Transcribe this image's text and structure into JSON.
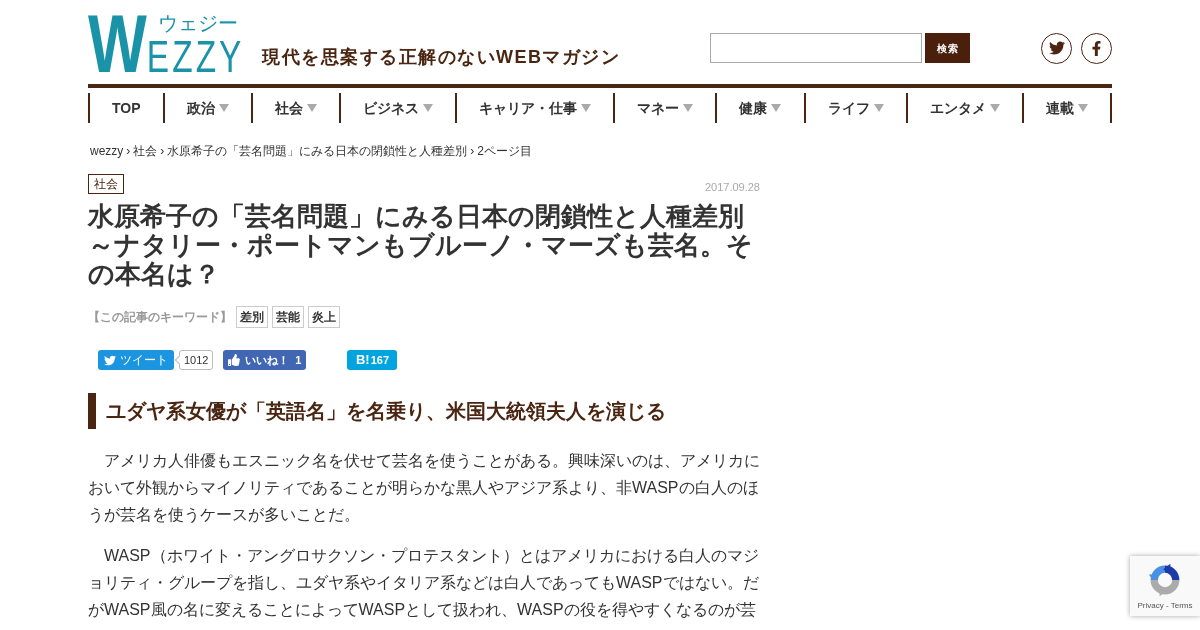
{
  "header": {
    "logo": {
      "text": "WEZZY",
      "kana": "ウェジー"
    },
    "tagline": "現代を思案する正解のないWEBマガジン",
    "search": {
      "button": "検索"
    }
  },
  "nav": [
    {
      "label": "TOP",
      "has_menu": false
    },
    {
      "label": "政治",
      "has_menu": true
    },
    {
      "label": "社会",
      "has_menu": true
    },
    {
      "label": "ビジネス",
      "has_menu": true
    },
    {
      "label": "キャリア・仕事",
      "has_menu": true
    },
    {
      "label": "マネー",
      "has_menu": true
    },
    {
      "label": "健康",
      "has_menu": true
    },
    {
      "label": "ライフ",
      "has_menu": true
    },
    {
      "label": "エンタメ",
      "has_menu": true
    },
    {
      "label": "連載",
      "has_menu": true
    }
  ],
  "breadcrumb": {
    "separator": "›",
    "items": [
      "wezzy",
      "社会",
      "水原希子の「芸名問題」にみる日本の閉鎖性と人種差別",
      "2ページ目"
    ]
  },
  "article": {
    "category": "社会",
    "date": "2017.09.28",
    "title": "水原希子の「芸名問題」にみる日本の閉鎖性と人種差別～ナタリー・ポートマンもブルーノ・マーズも芸名。その本名は？",
    "keywords_label": "【この記事のキーワード】",
    "keywords": [
      "差別",
      "芸能",
      "炎上"
    ],
    "share": [
      {
        "kind": "tweet",
        "label": "ツイート",
        "count": "1012"
      },
      {
        "kind": "like",
        "label": "いいね！",
        "count": "1"
      },
      {
        "kind": "hatena",
        "label": "B!",
        "count": "167"
      }
    ],
    "section_heading": "ユダヤ系女優が「英語名」を名乗り、米国大統領夫人を演じる",
    "paragraphs": [
      "アメリカ人俳優もエスニック名を伏せて芸名を使うことがある。興味深いのは、アメリカにおいて外観からマイノリティであることが明らかな黒人やアジア系より、非WASPの白人のほうが芸名を使うケースが多いことだ。",
      "WASP（ホワイト・アングロサクソン・プロテスタント）とはアメリカにおける白人のマジョリティ・グループを指し、ユダヤ系やイタリア系などは白人であってもWASPではない。だがWASP風の名に変えることによってWASPとして扱われ、WASPの役を得やすくなるのが芸"
    ]
  },
  "recaptcha": {
    "links": "Privacy - Terms"
  }
}
